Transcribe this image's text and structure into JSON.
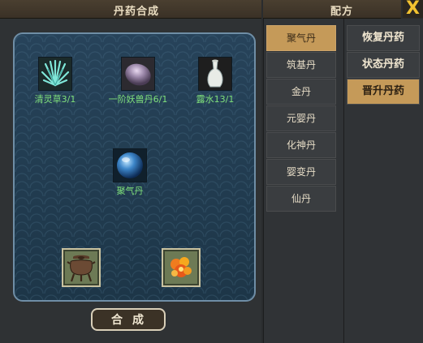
{
  "header": {
    "left_title": "丹药合成",
    "right_title": "配方",
    "close_label": "X"
  },
  "ingredients": [
    {
      "name": "清灵草3/1",
      "icon": "herb-icon"
    },
    {
      "name": "一阶妖兽丹6/1",
      "icon": "beast-core-icon"
    },
    {
      "name": "露水13/1",
      "icon": "vase-icon"
    }
  ],
  "result": {
    "name": "聚气丹",
    "icon": "pill-icon"
  },
  "slots": [
    {
      "icon": "cauldron-icon"
    },
    {
      "icon": "fire-icon"
    }
  ],
  "combine_label": "合成",
  "pill_list": [
    "聚气丹",
    "筑基丹",
    "金丹",
    "元婴丹",
    "化神丹",
    "婴变丹",
    "仙丹"
  ],
  "selected_pill": "聚气丹",
  "categories": [
    "恢复丹药",
    "状态丹药",
    "晋升丹药"
  ],
  "selected_category": "晋升丹药",
  "colors": {
    "accent": "#c59a59",
    "ingredient_text": "#7fe07a",
    "close": "#f2c230"
  }
}
